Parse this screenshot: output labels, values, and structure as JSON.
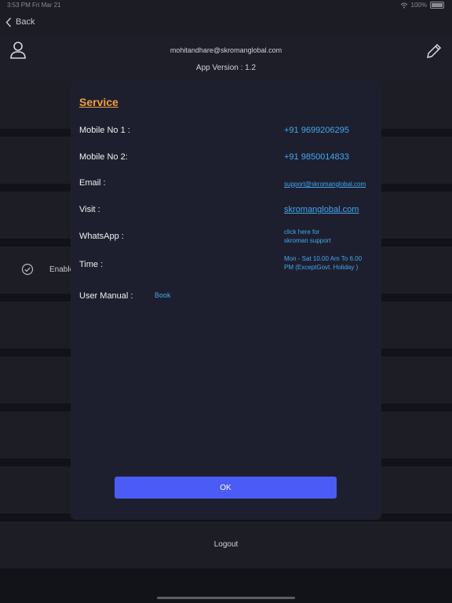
{
  "status_bar": {
    "time": "3:53 PM",
    "date": "Fri Mar 21",
    "battery": "100%"
  },
  "nav": {
    "back_label": "Back"
  },
  "profile": {
    "email": "mohitandhare@skromanglobal.com",
    "version": "App Version : 1.2"
  },
  "settings": {
    "enable_label": "Enable",
    "logout_label": "Logout"
  },
  "service_dialog": {
    "title": "Service",
    "mobile1_label": "Mobile No 1 :",
    "mobile1_value": "+91 9699206295",
    "mobile2_label": "Mobile No 2:",
    "mobile2_value": "+91 9850014833",
    "email_label": "Email :",
    "email_value": "support@skromanglobal.com",
    "visit_label": "Visit :",
    "visit_value": "skromanglobal.com",
    "whatsapp_label": "WhatsApp :",
    "whatsapp_line1": "click here for",
    "whatsapp_line2": "skroman support",
    "time_label": "Time :",
    "time_line1": "Mon - Sat 10.00 Am To 6.00",
    "time_line2": "PM (ExceptGovt. Holiday )",
    "manual_label": "User Manual :",
    "manual_value": "Book",
    "ok_label": "OK"
  },
  "colors": {
    "accent": "#4a5cf5",
    "title": "#f2a03d",
    "link": "#3fa9f0",
    "modal_bg": "#1e1f2e"
  }
}
